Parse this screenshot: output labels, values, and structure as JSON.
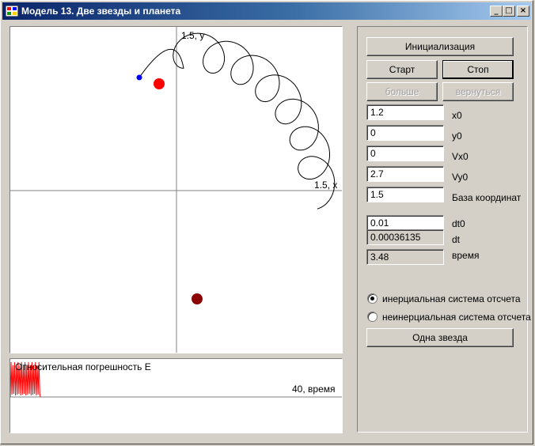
{
  "window": {
    "title": "Модель 13. Две звезды и планета",
    "minimize_glyph": "_",
    "maximize_glyph": "□",
    "close_glyph": "×"
  },
  "plot": {
    "x_axis_label": "1.5, x",
    "y_axis_label": "1.5, y"
  },
  "error_plot": {
    "y_label": "Относительная погрешность E",
    "x_label": "40, время",
    "line_color": "#ff0000"
  },
  "buttons": {
    "init": "Инициализация",
    "start": "Старт",
    "stop": "Стоп",
    "more": "больше",
    "back": "вернуться",
    "one_star": "Одна звезда"
  },
  "fields": {
    "x0": {
      "value": "1.2",
      "label": "x0"
    },
    "y0": {
      "value": "0",
      "label": "y0"
    },
    "vx0": {
      "value": "0",
      "label": "Vx0"
    },
    "vy0": {
      "value": "2.7",
      "label": "Vy0"
    },
    "base": {
      "value": "1.5",
      "label": "База координат"
    },
    "dt0": {
      "value": "0.01",
      "label": "dt0"
    },
    "dt": {
      "value": "0.00036135",
      "label": "dt"
    },
    "time": {
      "value": "3.48",
      "label": "время"
    }
  },
  "radios": {
    "inertial": {
      "label": "инерциальная система отсчета",
      "checked": true
    },
    "noninertial": {
      "label": "неинерциальная система отсчета",
      "checked": false
    }
  },
  "bodies": {
    "planet_color": "#0000ff",
    "star1_color": "#ff0000",
    "star2_color": "#8b0000"
  },
  "colors": {
    "face": "#d4d0c8",
    "title_start": "#0a246a",
    "title_end": "#a6caf0"
  }
}
